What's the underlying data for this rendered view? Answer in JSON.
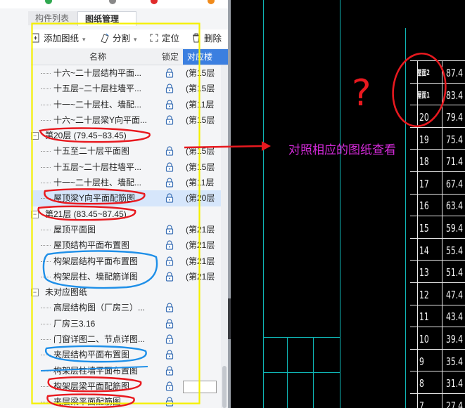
{
  "tabs": [
    {
      "label": "构件列表"
    },
    {
      "label": "图纸管理"
    }
  ],
  "toolbar": {
    "add_label": "添加图纸",
    "split_label": "分割",
    "locate_label": "定位",
    "delete_label": "删除"
  },
  "table_header": {
    "name": "名称",
    "lock": "锁定",
    "match": "对应楼"
  },
  "tree": [
    {
      "type": "item",
      "name": "十六~二十层结构平面...",
      "match": "(第15层"
    },
    {
      "type": "item",
      "name": "十五层~二十层柱墙平...",
      "match": "(第15层"
    },
    {
      "type": "item",
      "name": "十一~二十层柱、墙配...",
      "match": "(第11层"
    },
    {
      "type": "item",
      "name": "十六~二十层梁Y向平面...",
      "match": "(第15层"
    },
    {
      "type": "group",
      "name": "第20层 (79.45~83.45)"
    },
    {
      "type": "item",
      "name": "十五至二十层平面图",
      "match": "(第15层"
    },
    {
      "type": "item",
      "name": "十五层~二十层柱墙平...",
      "match": "(第15层"
    },
    {
      "type": "item",
      "name": "十一~二十层柱、墙配...",
      "match": "(第11层"
    },
    {
      "type": "item",
      "name": "屋顶梁Y向平面配筋图",
      "match": "(第20层",
      "selected": true
    },
    {
      "type": "group",
      "name": "第21层 (83.45~87.45)"
    },
    {
      "type": "item",
      "name": "屋顶平面图",
      "match": "(第21层"
    },
    {
      "type": "item",
      "name": "屋顶结构平面布置图",
      "match": "(第21层"
    },
    {
      "type": "item",
      "name": "构架层结构平面布置图",
      "match": "(第21层"
    },
    {
      "type": "item",
      "name": "构架层柱、墙配筋详图",
      "match": "(第21层"
    },
    {
      "type": "group",
      "name": "未对应图纸"
    },
    {
      "type": "item",
      "name": "高层结构图（厂房三）...",
      "match": ""
    },
    {
      "type": "item",
      "name": "厂房三3.16",
      "match": ""
    },
    {
      "type": "item",
      "name": "门窗详图二、节点详图...",
      "match": ""
    },
    {
      "type": "item",
      "name": "夹层结构平面布置图",
      "match": ""
    },
    {
      "type": "item",
      "name": "构架层柱墙平面布置图",
      "match": ""
    },
    {
      "type": "item",
      "name": "构架层梁平面配筋图",
      "match": ""
    },
    {
      "type": "item",
      "name": "夹层梁平面配筋图",
      "match": ""
    }
  ],
  "annotation": {
    "question_mark": "?",
    "text": "对照相应的图纸查看"
  },
  "cad_table": {
    "top_labels": [
      "屋面2",
      "屋面1"
    ],
    "rows": [
      {
        "floor": "20",
        "elev": "79.4"
      },
      {
        "floor": "19",
        "elev": "75.4"
      },
      {
        "floor": "18",
        "elev": "71.4"
      },
      {
        "floor": "17",
        "elev": "67.4"
      },
      {
        "floor": "16",
        "elev": "63.4"
      },
      {
        "floor": "15",
        "elev": "59.4"
      },
      {
        "floor": "14",
        "elev": "55.4"
      },
      {
        "floor": "13",
        "elev": "51.4"
      },
      {
        "floor": "12",
        "elev": "47.4"
      },
      {
        "floor": "11",
        "elev": "43.4"
      },
      {
        "floor": "10",
        "elev": "39.4"
      },
      {
        "floor": "9",
        "elev": "35.4"
      },
      {
        "floor": "8",
        "elev": "31.4"
      },
      {
        "floor": "7",
        "elev": "27.4"
      }
    ],
    "top_elevs": [
      "87.4",
      "83.4"
    ]
  },
  "colors": {
    "accent": "#3b7fe0",
    "cad_line": "#0fb5b5",
    "annotation_red": "#e8191f",
    "annotation_blue": "#1e8fe8",
    "annotation_yellow": "#f5f000",
    "annotation_text": "#d42ad9"
  }
}
